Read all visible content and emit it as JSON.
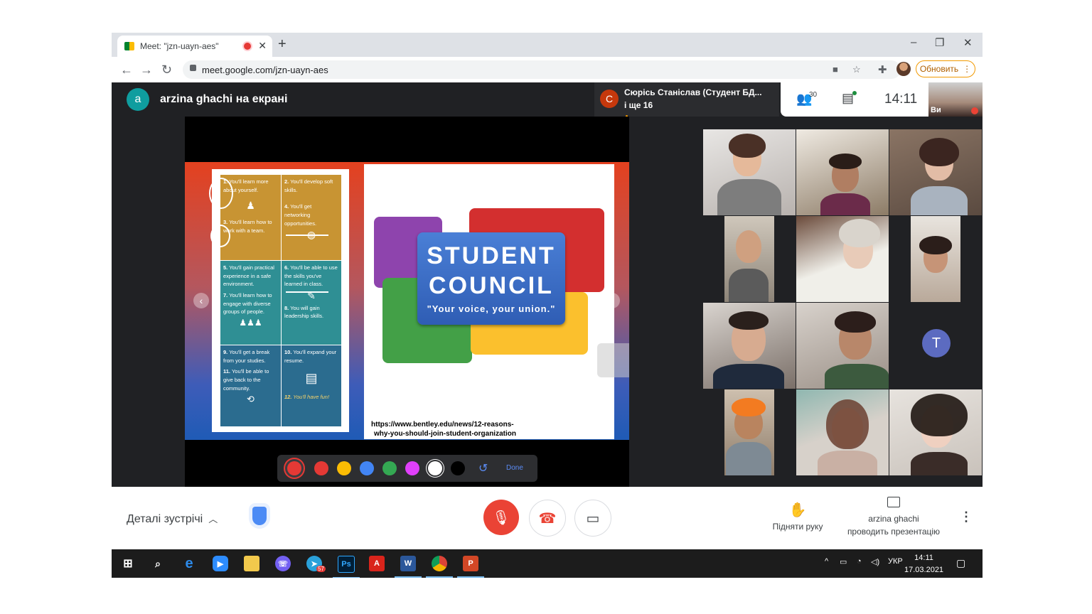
{
  "browser": {
    "tab_title": "Meet: \"jzn-uayn-aes\"",
    "url": "meet.google.com/jzn-uayn-aes",
    "update_label": "Обновить"
  },
  "meet": {
    "presenter_initial": "a",
    "presenter_text": "arzina ghachi на екрані",
    "speaker_initial": "С",
    "speaker_name": "Сюрісь Станіслав (Студент БД...",
    "speaker_more": "і ще 16",
    "participant_count": "30",
    "time": "14:11",
    "self_label": "Ви",
    "grid_avatar_initial": "T"
  },
  "slide": {
    "items": [
      {
        "num": "1.",
        "text": "You'll learn more about yourself."
      },
      {
        "num": "2.",
        "text": "You'll develop soft skills."
      },
      {
        "num": "3.",
        "text": "You'll learn how to work with a team."
      },
      {
        "num": "4.",
        "text": "You'll get networking opportunities."
      },
      {
        "num": "5.",
        "text": "You'll gain practical experience in a safe environment."
      },
      {
        "num": "6.",
        "text": "You'll be able to use the skills you've learned in class."
      },
      {
        "num": "7.",
        "text": "You'll learn how to engage with diverse groups of people."
      },
      {
        "num": "8.",
        "text": "You will gain leadership skills."
      },
      {
        "num": "9.",
        "text": "You'll get a break from your studies."
      },
      {
        "num": "10.",
        "text": "You'll expand your resume."
      },
      {
        "num": "11.",
        "text": "You'll be able to give back to the community."
      },
      {
        "num": "12.",
        "text": "You'll have fun!"
      }
    ],
    "council_line1": "STUDENT",
    "council_line2": "COUNCIL",
    "council_tagline": "\"Your voice, your union.\"",
    "source_line1": "https://www.bentley.edu/news/12-reasons-",
    "source_line2": "why-you-should-join-student-organization"
  },
  "pen_tray": {
    "colors": [
      "#e53935",
      "#fbbc04",
      "#4285f4",
      "#34a853",
      "#e040fb",
      "#ffffff",
      "#000000"
    ],
    "done_label": "Done"
  },
  "controls": {
    "details_label": "Деталі зустрічі",
    "raise_hand_label": "Підняти руку",
    "presenting_line1": "arzina ghachi",
    "presenting_line2": "проводить презентацію"
  },
  "taskbar": {
    "telegram_badge": "57",
    "lang": "УКР",
    "time": "14:11",
    "date": "17.03.2021"
  },
  "colors": {
    "meet_bg": "#202124",
    "accent_red": "#ea4335",
    "presenter_teal": "#0f9d9f"
  }
}
